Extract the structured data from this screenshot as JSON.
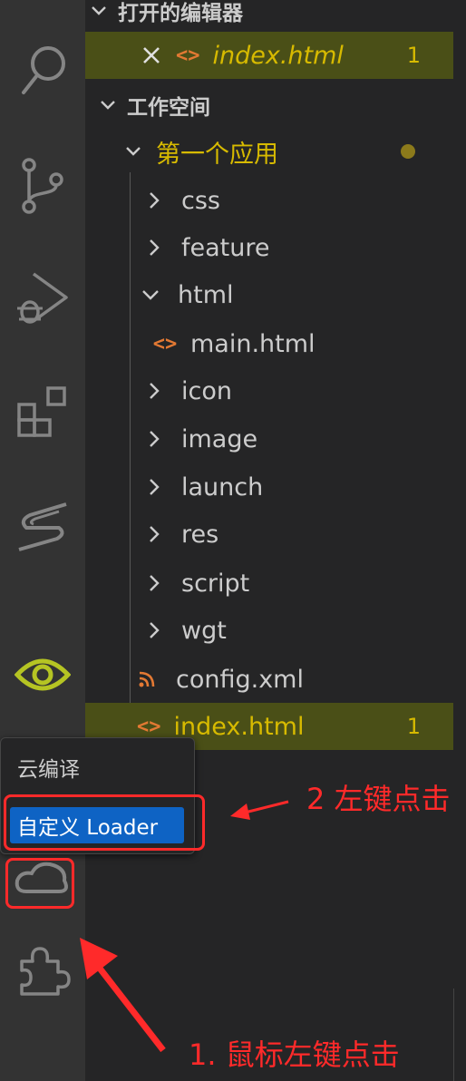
{
  "explorer": {
    "open_editors": {
      "title": "打开的编辑器",
      "file": {
        "name": "index.html",
        "problems": "1"
      }
    },
    "workspace": {
      "title": "工作空间",
      "root": {
        "name": "第一个应用"
      },
      "items": [
        {
          "name": "css",
          "type": "folder"
        },
        {
          "name": "feature",
          "type": "folder"
        },
        {
          "name": "html",
          "type": "folder-open"
        },
        {
          "name": "main.html",
          "type": "html-file"
        },
        {
          "name": "icon",
          "type": "folder"
        },
        {
          "name": "image",
          "type": "folder"
        },
        {
          "name": "launch",
          "type": "folder"
        },
        {
          "name": "res",
          "type": "folder"
        },
        {
          "name": "script",
          "type": "folder"
        },
        {
          "name": "wgt",
          "type": "folder"
        },
        {
          "name": "config.xml",
          "type": "rss-file"
        }
      ],
      "active_file": {
        "name": "index.html",
        "problems": "1"
      }
    }
  },
  "activity_bar": {
    "icons": [
      "search-icon",
      "source-control-icon",
      "run-debug-icon",
      "extensions-blocks-icon",
      "s-logo-icon",
      "eye-icon",
      "cloud-icon",
      "puzzle-extensions-icon"
    ]
  },
  "context_menu": {
    "items": [
      "云编译",
      "自定义 Loader"
    ]
  },
  "annotations": {
    "step1": "1. 鼠标左键点击",
    "step2": "2 左键点击"
  },
  "colors": {
    "highlight": "#4a4f17",
    "warning_yellow": "#d7ba00",
    "annotation_red": "#ff2a2a",
    "menu_selected": "#0e63c4",
    "eye_green": "#b5c423"
  }
}
